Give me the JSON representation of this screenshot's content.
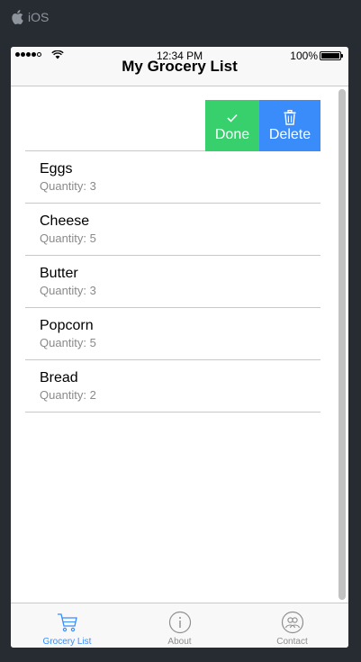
{
  "platform": {
    "label": "iOS",
    "icon": "apple-icon"
  },
  "statusbar": {
    "time": "12:34 PM",
    "battery": "100%"
  },
  "navbar": {
    "title": "My Grocery List"
  },
  "swipe_actions": [
    {
      "label": "Done",
      "icon": "check-icon",
      "color": "#37d06c"
    },
    {
      "label": "Delete",
      "icon": "trash-icon",
      "color": "#3b8cfb"
    }
  ],
  "items": [
    {
      "name": "Eggs",
      "quantity": "Quantity: 3"
    },
    {
      "name": "Cheese",
      "quantity": "Quantity: 5"
    },
    {
      "name": "Butter",
      "quantity": "Quantity: 3"
    },
    {
      "name": "Popcorn",
      "quantity": "Quantity: 5"
    },
    {
      "name": "Bread",
      "quantity": "Quantity: 2"
    }
  ],
  "tabs": [
    {
      "label": "Grocery List",
      "icon": "cart-icon",
      "active": true
    },
    {
      "label": "About",
      "icon": "info-icon",
      "active": false
    },
    {
      "label": "Contact",
      "icon": "contacts-icon",
      "active": false
    }
  ],
  "colors": {
    "accent": "#3b8cfb",
    "done": "#37d06c",
    "background": "#272c33"
  }
}
